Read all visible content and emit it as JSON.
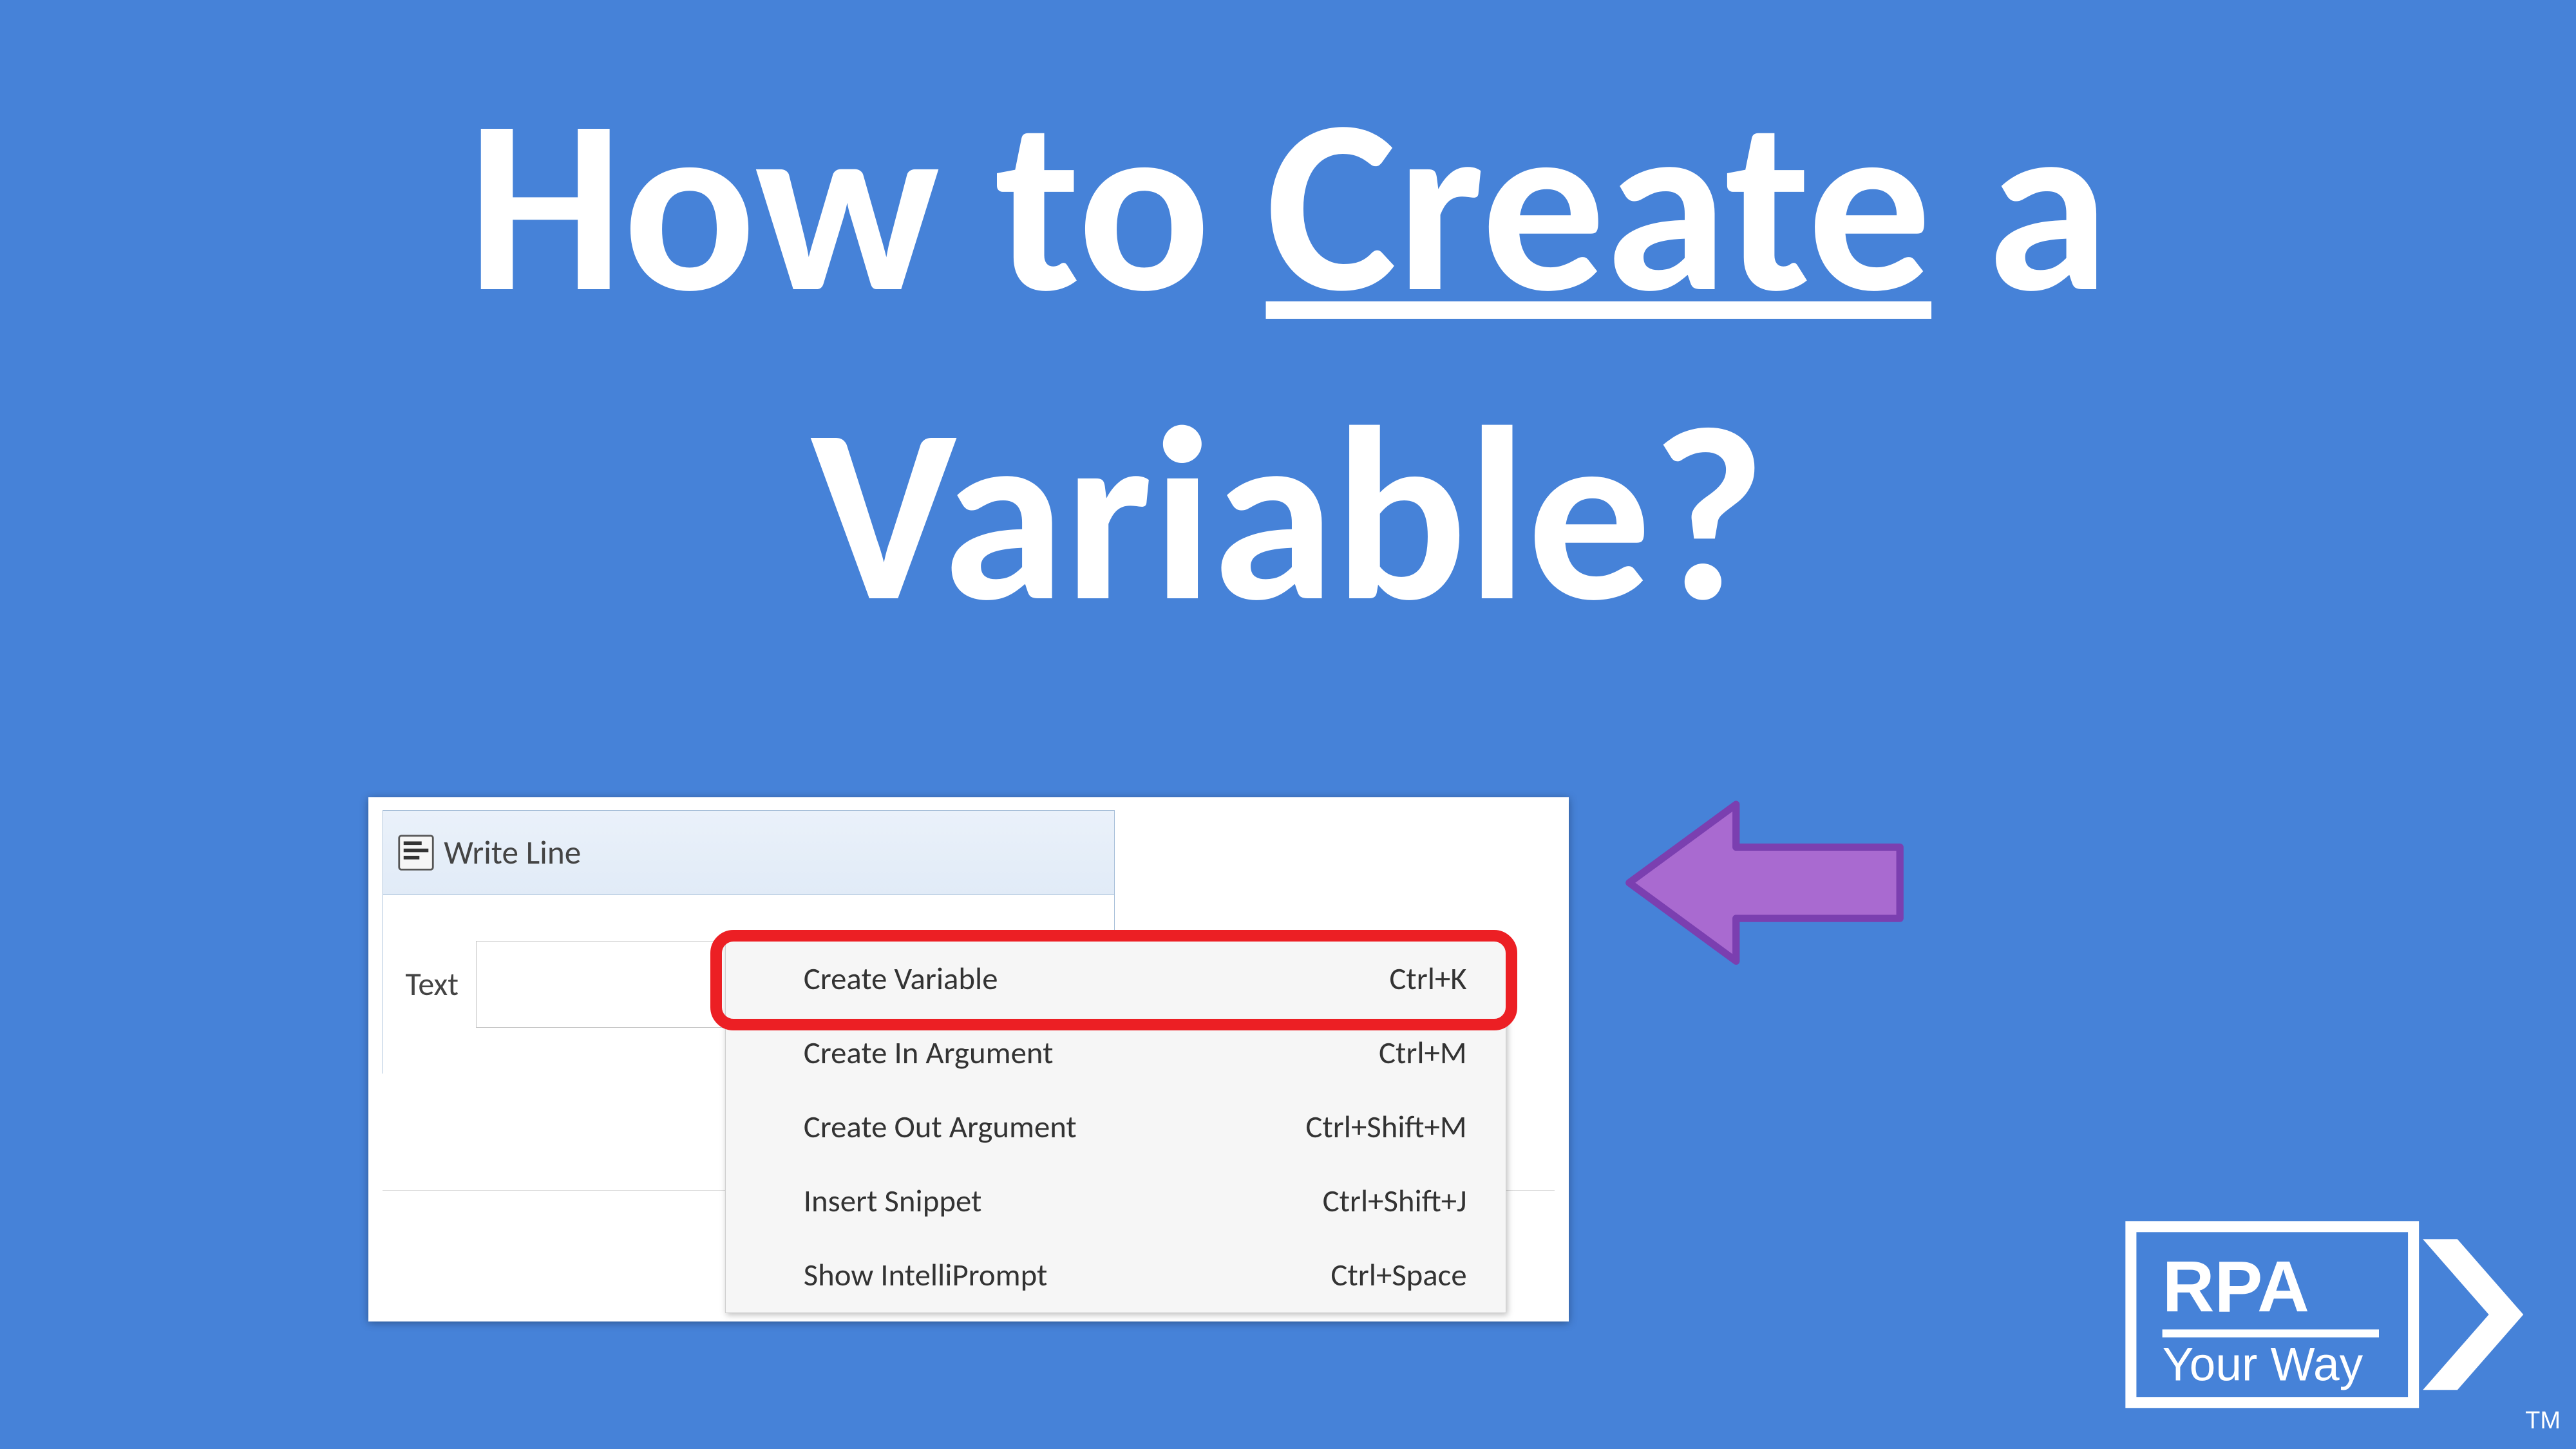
{
  "title": {
    "line1_prefix": "How to ",
    "line1_underlined": "Create",
    "line1_suffix": " a",
    "line2": "Variable?"
  },
  "activity": {
    "name": "Write Line",
    "field_label": "Text",
    "field_value": ""
  },
  "context_menu": {
    "items": [
      {
        "label": "Create Variable",
        "shortcut": "Ctrl+K",
        "highlighted": true
      },
      {
        "label": "Create In Argument",
        "shortcut": "Ctrl+M",
        "highlighted": false
      },
      {
        "label": "Create Out Argument",
        "shortcut": "Ctrl+Shift+M",
        "highlighted": false
      },
      {
        "label": "Insert Snippet",
        "shortcut": "Ctrl+Shift+J",
        "highlighted": false
      },
      {
        "label": "Show IntelliPrompt",
        "shortcut": "Ctrl+Space",
        "highlighted": false
      }
    ]
  },
  "arrow": {
    "fill": "#a96ad0",
    "stroke": "#7b3fb0"
  },
  "highlight_box": {
    "color": "#ec1f24"
  },
  "logo": {
    "line1": "RPA",
    "line2": "Your Way",
    "trademark": "TM"
  },
  "colors": {
    "background": "#4682d8",
    "title": "#ffffff"
  }
}
